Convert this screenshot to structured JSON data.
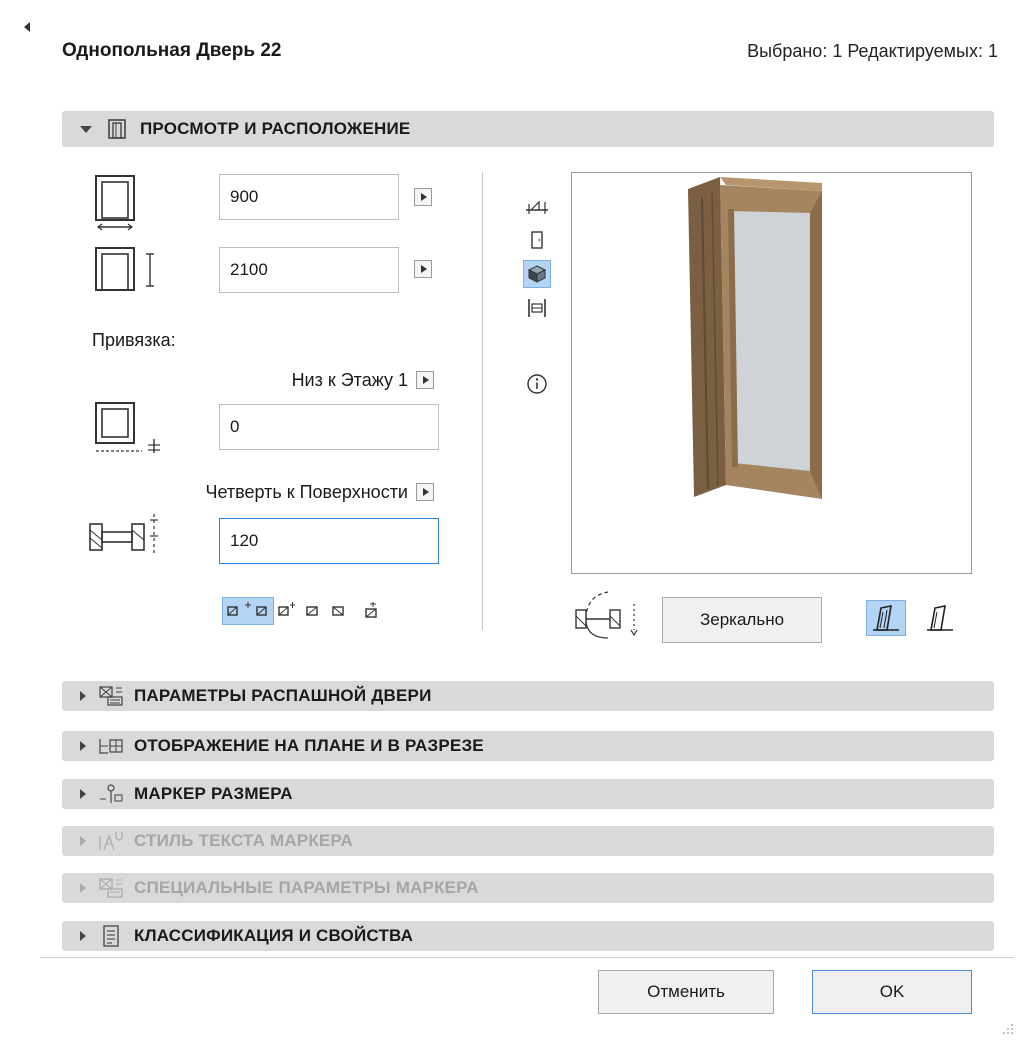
{
  "dialog": {
    "title": "Однопольная Дверь 22",
    "selection_info": "Выбрано: 1 Редактируемых: 1"
  },
  "sections": {
    "view_placement": {
      "label": "ПРОСМОТР И РАСПОЛОЖЕНИЕ",
      "icon": "door-frame-icon",
      "expanded": true
    },
    "collapsed": [
      {
        "label": "ПАРАМЕТРЫ РАСПАШНОЙ ДВЕРИ",
        "icon": "door-parameters-icon",
        "enabled": true
      },
      {
        "label": "ОТОБРАЖЕНИЕ НА ПЛАНЕ И В РАЗРЕЗЕ",
        "icon": "plan-section-icon",
        "enabled": true
      },
      {
        "label": "МАРКЕР РАЗМЕРА",
        "icon": "dimension-marker-icon",
        "enabled": true
      },
      {
        "label": "СТИЛЬ ТЕКСТА МАРКЕРА",
        "icon": "marker-text-style-icon",
        "enabled": false
      },
      {
        "label": "СПЕЦИАЛЬНЫЕ ПАРАМЕТРЫ МАРКЕРА",
        "icon": "marker-custom-params-icon",
        "enabled": false
      },
      {
        "label": "КЛАССИФИКАЦИЯ И СВОЙСТВА",
        "icon": "classification-document-icon",
        "enabled": true
      }
    ]
  },
  "fields": {
    "width": "900",
    "height": "2100",
    "anchor_label": "Привязка:",
    "anchor_mode": "Низ к Этажу 1",
    "anchor_value": "0",
    "reveal_mode": "Четверть к Поверхности",
    "reveal_value": "120"
  },
  "preview": {
    "side_icons": [
      "floor-plan-preview-icon",
      "elevation-preview-icon",
      "3d-preview-icon",
      "section-preview-icon",
      "info-icon"
    ],
    "selected_view": "3d-preview-icon"
  },
  "buttons": {
    "mirror": "Зеркально",
    "cancel": "Отменить",
    "ok": "OK"
  },
  "colors": {
    "selection_blue": "#b3d4f5",
    "header_gray": "#d9d9d9",
    "door_wood": "#a5855f",
    "door_glass": "#cfd2d6"
  }
}
